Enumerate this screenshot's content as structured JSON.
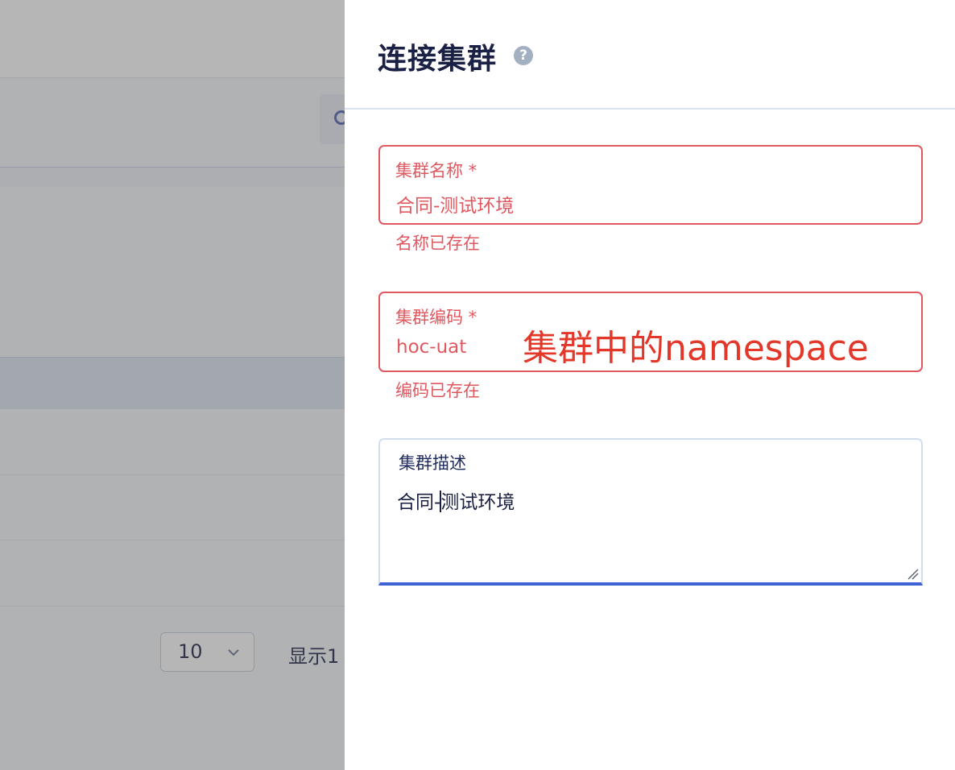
{
  "background": {
    "pagination": {
      "page_size": "10",
      "showing_text": "显示1"
    }
  },
  "drawer": {
    "title": "连接集群",
    "help_icon_glyph": "?",
    "fields": {
      "cluster_name": {
        "label": "集群名称 *",
        "value": "合同-测试环境",
        "error": "名称已存在"
      },
      "cluster_code": {
        "label": "集群编码 *",
        "value": "hoc-uat",
        "error": "编码已存在"
      },
      "cluster_description": {
        "label": "集群描述",
        "value_before_caret": "合同-",
        "value_after_caret": "测试环境"
      }
    },
    "annotation": "集群中的namespace"
  },
  "colors": {
    "error": "#e0585f",
    "focus_underline": "#3d63d6",
    "annotation": "#e3372a",
    "title": "#1a2144"
  }
}
